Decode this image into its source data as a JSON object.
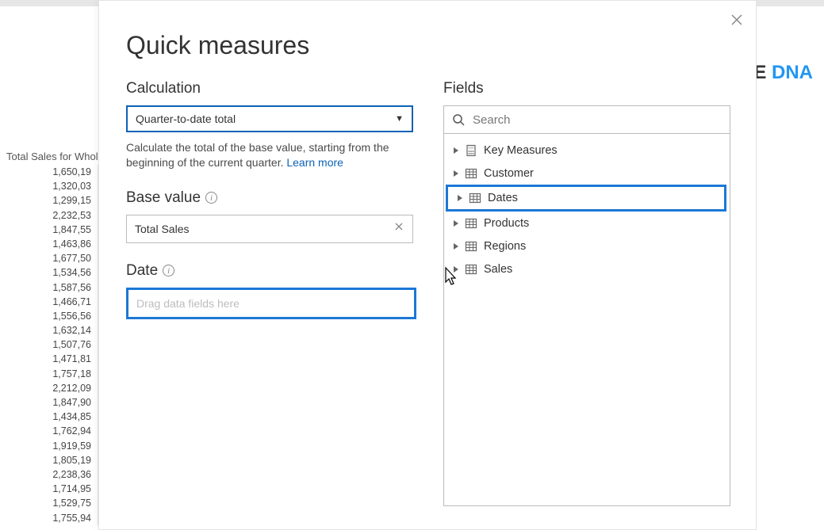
{
  "background": {
    "logo_prefix": "E",
    "logo_suffix": "DNA",
    "column_header": "Total Sales for Whole",
    "values": [
      "1,650,19",
      "1,320,03",
      "1,299,15",
      "2,232,53",
      "1,847,55",
      "1,463,86",
      "1,677,50",
      "1,534,56",
      "1,587,56",
      "1,466,71",
      "1,556,56",
      "1,632,14",
      "1,507,76",
      "1,471,81",
      "1,757,18",
      "2,212,09",
      "1,847,90",
      "1,434,85",
      "1,762,94",
      "1,919,59",
      "1,805,19",
      "2,238,36",
      "1,714,95",
      "1,529,75",
      "1,755,94"
    ]
  },
  "dialog": {
    "title": "Quick measures",
    "left": {
      "calculation_label": "Calculation",
      "calculation_value": "Quarter-to-date total",
      "description_text": "Calculate the total of the base value, starting from the beginning of the current quarter. ",
      "learn_more": "Learn more",
      "base_value_label": "Base value",
      "base_value_field": "Total Sales",
      "date_label": "Date",
      "date_placeholder": "Drag data fields here"
    },
    "right": {
      "fields_label": "Fields",
      "search_placeholder": "Search",
      "tables": [
        {
          "name": "Key Measures",
          "icon": "calc"
        },
        {
          "name": "Customer",
          "icon": "table"
        },
        {
          "name": "Dates",
          "icon": "table",
          "highlight": true
        },
        {
          "name": "Products",
          "icon": "table"
        },
        {
          "name": "Regions",
          "icon": "table"
        },
        {
          "name": "Sales",
          "icon": "table"
        }
      ]
    }
  }
}
